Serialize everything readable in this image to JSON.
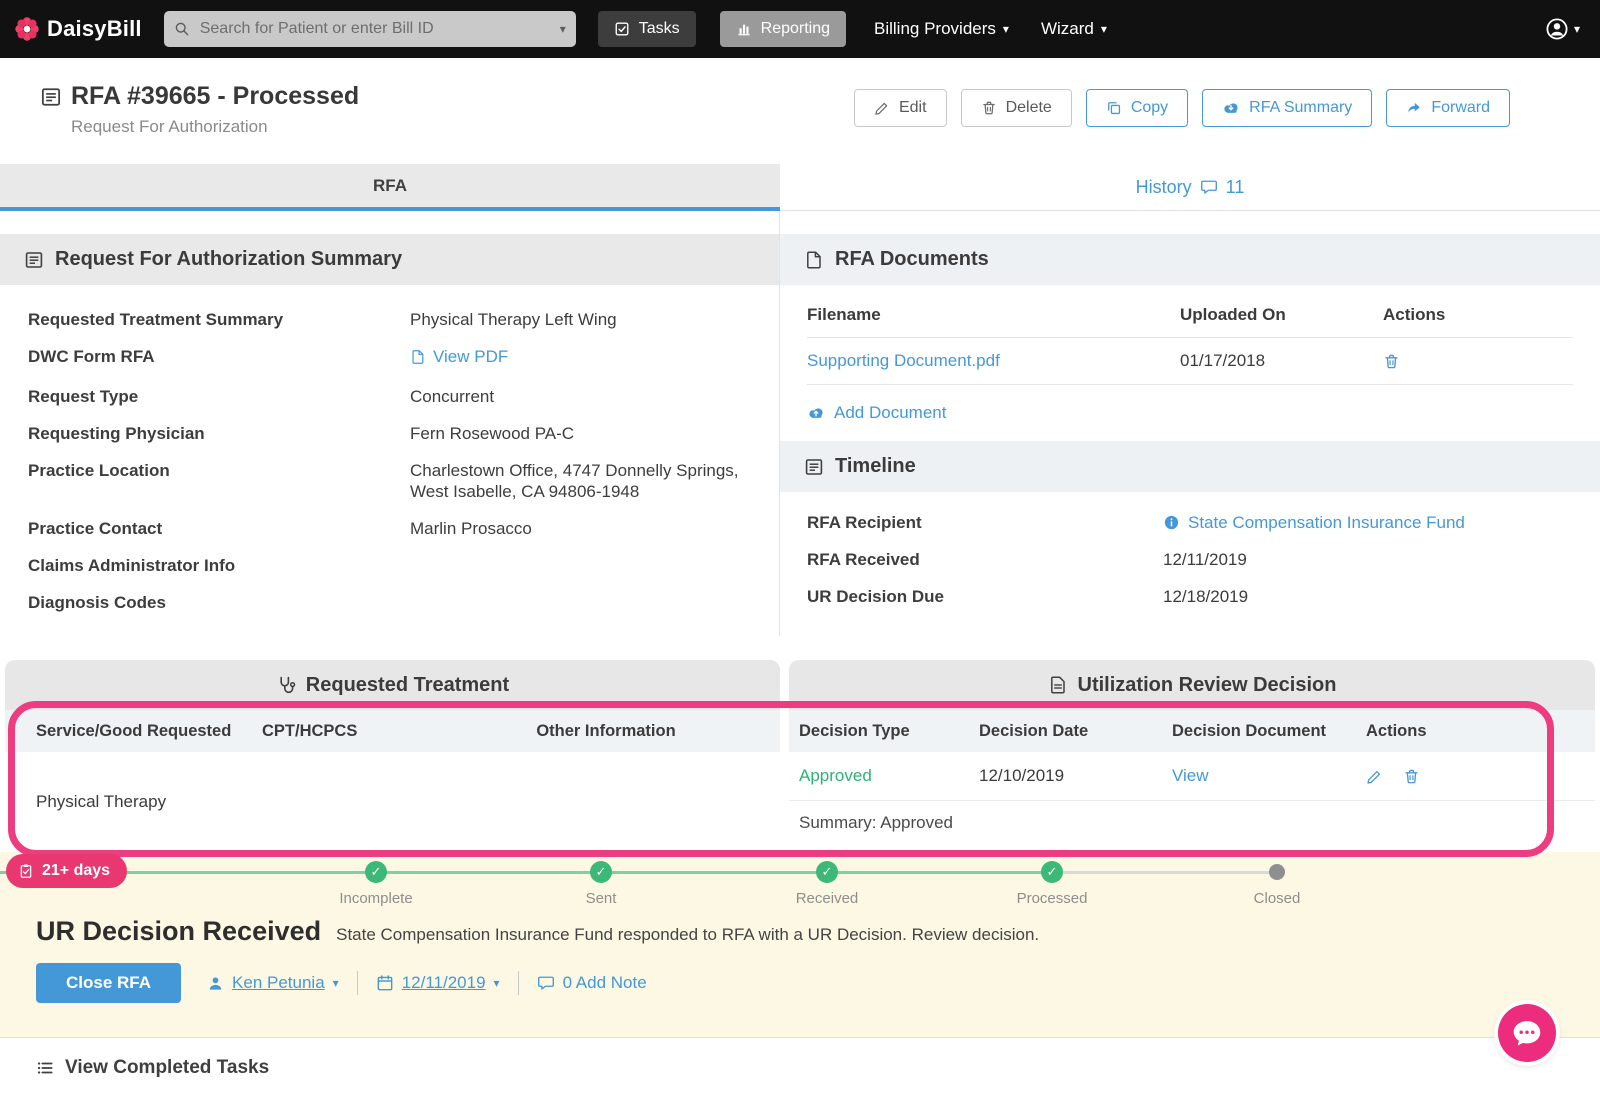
{
  "nav": {
    "brand": "DaisyBill",
    "search_placeholder": "Search for Patient or enter Bill ID",
    "tasks": "Tasks",
    "reporting": "Reporting",
    "billing_providers": "Billing Providers",
    "wizard": "Wizard"
  },
  "header": {
    "title": "RFA #39665 - Processed",
    "subtitle": "Request For Authorization",
    "buttons": {
      "edit": "Edit",
      "delete": "Delete",
      "copy": "Copy",
      "rfa_summary": "RFA Summary",
      "forward": "Forward"
    }
  },
  "tabs": {
    "rfa": "RFA",
    "history": "History",
    "history_count": "11"
  },
  "summary": {
    "title": "Request For Authorization Summary",
    "rows": [
      {
        "label": "Requested Treatment Summary",
        "value": "Physical Therapy Left Wing"
      },
      {
        "label": "DWC Form RFA",
        "value": "View PDF"
      },
      {
        "label": "Request Type",
        "value": "Concurrent"
      },
      {
        "label": "Requesting Physician",
        "value": "Fern Rosewood PA-C"
      },
      {
        "label": "Practice Location",
        "value": "Charlestown Office, 4747 Donnelly Springs, West Isabelle, CA 94806-1948"
      },
      {
        "label": "Practice Contact",
        "value": "Marlin Prosacco"
      },
      {
        "label": "Claims Administrator Info",
        "value": ""
      },
      {
        "label": "Diagnosis Codes",
        "value": ""
      }
    ]
  },
  "documents": {
    "title": "RFA Documents",
    "columns": [
      "Filename",
      "Uploaded On",
      "Actions"
    ],
    "rows": [
      {
        "filename": "Supporting Document.pdf",
        "uploaded_on": "01/17/2018"
      }
    ],
    "add_label": "Add Document"
  },
  "timeline": {
    "title": "Timeline",
    "rows": [
      {
        "label": "RFA Recipient",
        "value": "State Compensation Insurance Fund"
      },
      {
        "label": "RFA Received",
        "value": "12/11/2019"
      },
      {
        "label": "UR Decision Due",
        "value": "12/18/2019"
      }
    ]
  },
  "treatment": {
    "title": "Requested Treatment",
    "columns": [
      "Service/Good Requested",
      "CPT/HCPCS",
      "Other Information"
    ],
    "rows": [
      {
        "service": "Physical Therapy",
        "cpt": "",
        "other": ""
      }
    ]
  },
  "ur_decision": {
    "title": "Utilization Review Decision",
    "columns": [
      "Decision Type",
      "Decision Date",
      "Decision Document",
      "Actions"
    ],
    "rows": [
      {
        "decision_type": "Approved",
        "decision_date": "12/10/2019",
        "document": "View",
        "summary": "Summary: Approved"
      }
    ]
  },
  "progress": {
    "badge": "21+ days",
    "steps": [
      {
        "label": "Incomplete",
        "done": true
      },
      {
        "label": "Sent",
        "done": true
      },
      {
        "label": "Received",
        "done": true
      },
      {
        "label": "Processed",
        "done": true
      },
      {
        "label": "Closed",
        "done": false
      }
    ]
  },
  "task": {
    "title": "UR Decision Received",
    "description": "State Compensation Insurance Fund responded to RFA with a UR Decision. Review decision.",
    "close_button": "Close RFA",
    "assignee": "Ken Petunia",
    "date": "12/11/2019",
    "note": "0 Add Note"
  },
  "footer": {
    "view_completed_tasks": "View Completed Tasks"
  },
  "icons": {
    "caret_down": "▾",
    "check": "✓"
  },
  "colors": {
    "accent_blue": "#4598d8",
    "approved_green": "#2eb274",
    "progress_green": "#3cb878",
    "highlight_pink": "#ee3c80",
    "badge_pink": "#e9386f",
    "chat_pink": "#ec2d7d",
    "warning_bg": "#fcf8e3",
    "nav_bg": "#111111"
  }
}
